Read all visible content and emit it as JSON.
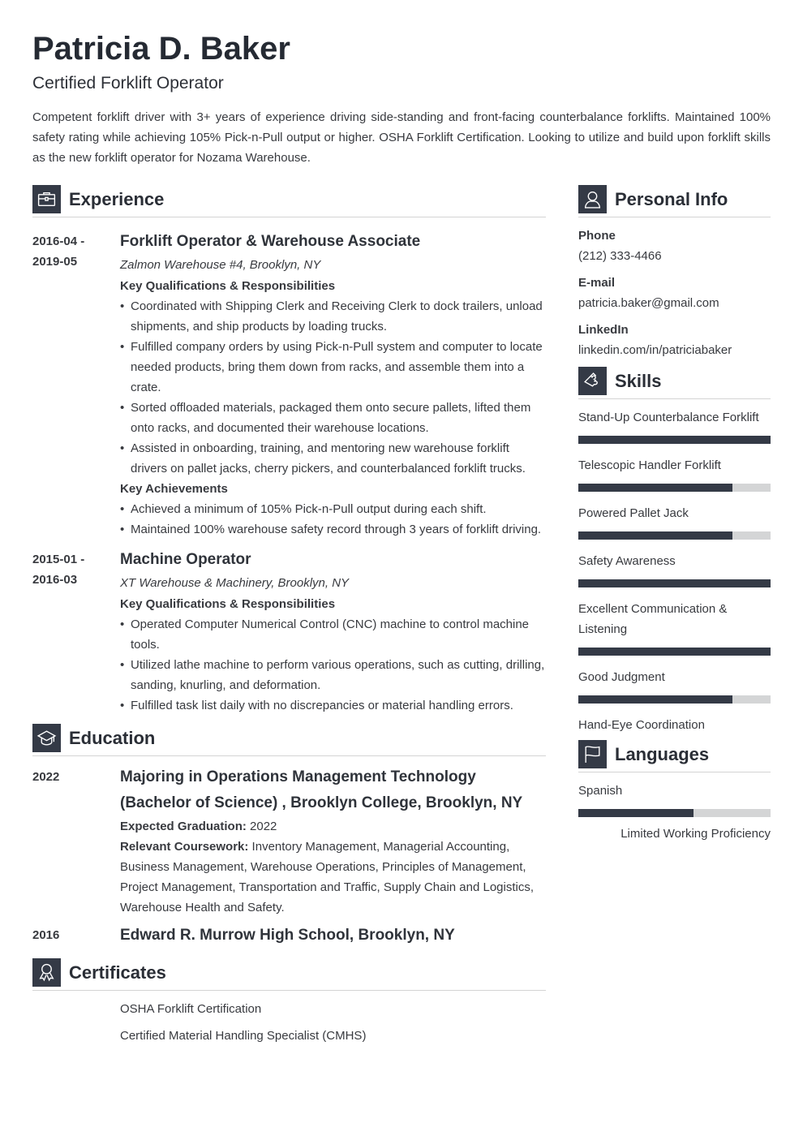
{
  "header": {
    "name": "Patricia D. Baker",
    "title": "Certified Forklift Operator",
    "summary": "Competent forklift driver with 3+ years of experience driving side-standing and front-facing counterbalance forklifts. Maintained 100% safety rating while achieving 105% Pick-n-Pull output or higher. OSHA Forklift Certification. Looking to utilize and build upon forklift skills as the new forklift operator for Nozama Warehouse."
  },
  "experience": {
    "heading": "Experience",
    "icon": "briefcase-icon",
    "jobs": [
      {
        "date_start": "2016-04 -",
        "date_end": "2019-05",
        "title": "Forklift Operator & Warehouse Associate",
        "company": "Zalmon Warehouse #4, Brooklyn, NY",
        "qual_heading": "Key Qualifications & Responsibilities",
        "responsibilities": [
          "Coordinated with Shipping Clerk and Receiving Clerk to dock trailers, unload shipments, and ship products by loading trucks.",
          "Fulfilled company orders by using Pick-n-Pull system and computer to locate needed products, bring them down from racks, and assemble them into a crate.",
          "Sorted offloaded materials, packaged them onto secure pallets, lifted them onto racks, and documented their warehouse locations.",
          "Assisted in onboarding, training, and mentoring new warehouse forklift drivers on pallet jacks, cherry pickers, and counterbalanced forklift trucks."
        ],
        "ach_heading": "Key Achievements",
        "achievements": [
          "Achieved a minimum of 105% Pick-n-Pull output during each shift.",
          "Maintained 100% warehouse safety record through 3 years of forklift driving."
        ]
      },
      {
        "date_start": "2015-01 -",
        "date_end": "2016-03",
        "title": "Machine Operator",
        "company": "XT Warehouse & Machinery, Brooklyn, NY",
        "qual_heading": "Key Qualifications & Responsibilities",
        "responsibilities": [
          "Operated Computer Numerical Control (CNC) machine to control machine tools.",
          "Utilized lathe machine to perform various operations, such as cutting, drilling, sanding, knurling, and deformation.",
          "Fulfilled task list daily with no discrepancies or material handling errors."
        ]
      }
    ]
  },
  "education": {
    "heading": "Education",
    "icon": "graduation-cap-icon",
    "items": [
      {
        "date": "2022",
        "title": "Majoring in Operations Management Technology (Bachelor of Science) , Brooklyn College, Brooklyn, NY",
        "grad_label": "Expected Graduation:",
        "grad_value": " 2022",
        "course_label": "Relevant Coursework:",
        "course_value": " Inventory Management, Managerial Accounting, Business Management, Warehouse Operations, Principles of Management, Project Management, Transportation and Traffic, Supply Chain and Logistics, Warehouse Health and Safety."
      },
      {
        "date": "2016",
        "title": "Edward R. Murrow High School, Brooklyn, NY"
      }
    ]
  },
  "certificates": {
    "heading": "Certificates",
    "icon": "award-ribbon-icon",
    "items": [
      "OSHA Forklift Certification",
      "Certified Material Handling Specialist (CMHS)"
    ]
  },
  "personal_info": {
    "heading": "Personal Info",
    "icon": "user-icon",
    "phone_label": "Phone",
    "phone": "(212) 333-4466",
    "email_label": "E-mail",
    "email": "patricia.baker@gmail.com",
    "linkedin_label": "LinkedIn",
    "linkedin": "linkedin.com/in/patriciabaker"
  },
  "skills": {
    "heading": "Skills",
    "icon": "puzzle-piece-icon",
    "items": [
      {
        "name": "Stand-Up Counterbalance Forklift",
        "level": 1.0
      },
      {
        "name": "Telescopic Handler Forklift",
        "level": 0.8
      },
      {
        "name": "Powered Pallet Jack",
        "level": 0.8
      },
      {
        "name": "Safety Awareness",
        "level": 1.0
      },
      {
        "name": "Excellent Communication & Listening",
        "level": 1.0
      },
      {
        "name": "Good Judgment",
        "level": 0.8
      },
      {
        "name": "Hand-Eye Coordination",
        "level": null
      }
    ]
  },
  "languages": {
    "heading": "Languages",
    "icon": "flag-icon",
    "items": [
      {
        "name": "Spanish",
        "level": 0.6,
        "level_label": "Limited Working Proficiency"
      }
    ]
  },
  "colors": {
    "accent": "#343a46",
    "bar_track": "#d4d5d6",
    "text": "#383a3f",
    "rule": "#d4d4d4"
  }
}
